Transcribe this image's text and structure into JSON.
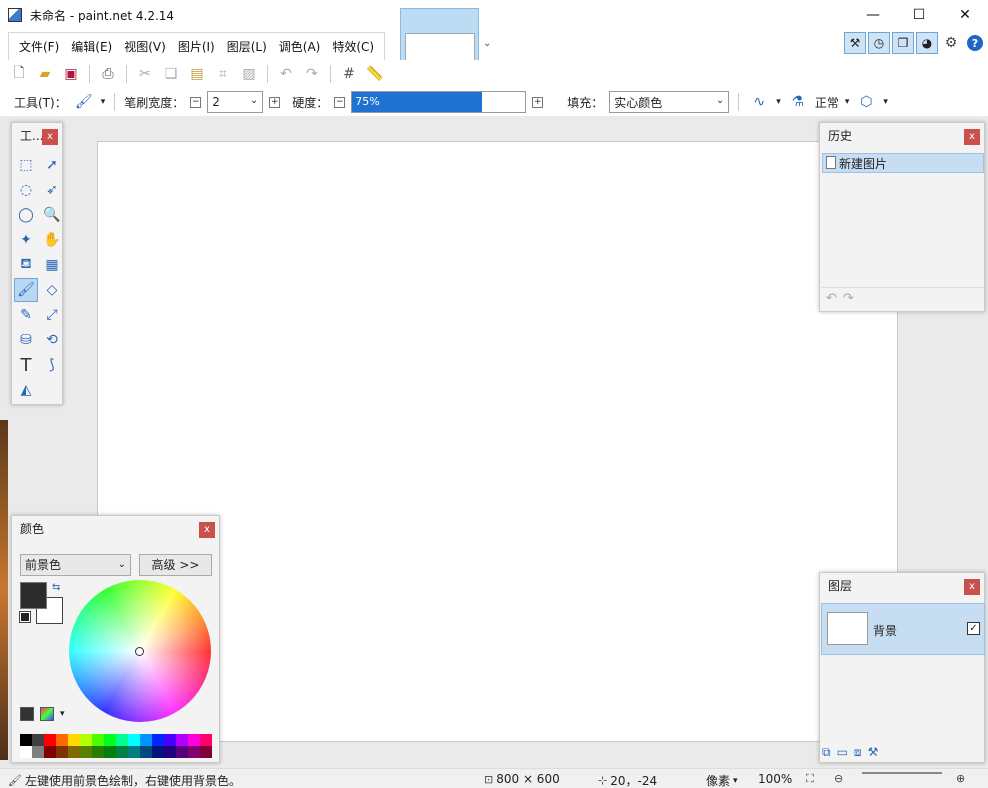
{
  "window": {
    "title": "未命名 - paint.net 4.2.14",
    "minimize": "—",
    "maximize": "☐",
    "close": "✕"
  },
  "menu": [
    "文件(F)",
    "编辑(E)",
    "视图(V)",
    "图片(I)",
    "图层(L)",
    "调色(A)",
    "特效(C)"
  ],
  "toolbar": {
    "tool_label": "工具(T)：",
    "brush_width_label": "笔刷宽度：",
    "brush_width_value": "2",
    "hardness_label": "硬度：",
    "hardness_value": "75%",
    "hardness_fraction": 0.75,
    "fill_label": "填充：",
    "fill_value": "实心颜色",
    "blend_value": "正常"
  },
  "tools_panel": {
    "title": "工...",
    "close": "x"
  },
  "history_panel": {
    "title": "历史",
    "close": "x",
    "items": [
      "新建图片"
    ]
  },
  "colors_panel": {
    "title": "颜色",
    "close": "x",
    "select_value": "前景色",
    "advanced_label": "高级 >>",
    "primary_color": "#2b2b2b",
    "secondary_color": "#ffffff",
    "palette_top": [
      "#000000",
      "#404040",
      "#ff0000",
      "#ff6a00",
      "#ffd800",
      "#b6ff00",
      "#4cff00",
      "#00ff21",
      "#00ff90",
      "#00ffff",
      "#0094ff",
      "#0026ff",
      "#4800ff",
      "#b200ff",
      "#ff00dc",
      "#ff006e"
    ],
    "palette_bottom": [
      "#ffffff",
      "#808080",
      "#7f0000",
      "#7f3300",
      "#7f6a00",
      "#5b7f00",
      "#267f00",
      "#007f0e",
      "#007f46",
      "#007f7f",
      "#004a7f",
      "#00137f",
      "#21007f",
      "#57007f",
      "#7f006e",
      "#7f0037"
    ]
  },
  "layers_panel": {
    "title": "图层",
    "close": "x",
    "layers": [
      {
        "name": "背景",
        "visible": true
      }
    ]
  },
  "status": {
    "hint": "左键使用前景色绘制，右键使用背景色。",
    "image_size": "800 × 600",
    "cursor_pos": "20，-24",
    "units": "像素",
    "zoom": "100%"
  }
}
